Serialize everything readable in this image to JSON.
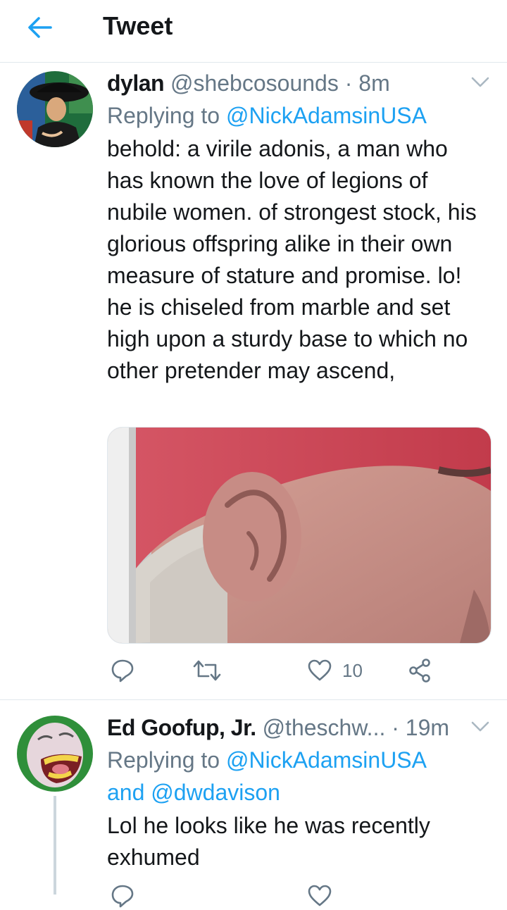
{
  "header": {
    "title": "Tweet",
    "back_icon": "arrow-left-icon",
    "accent": "#1da1f2"
  },
  "tweets": [
    {
      "name": "dylan",
      "handle": "@shebcosounds",
      "separator": "·",
      "time": "8m",
      "replying_prefix": "Replying to",
      "replying_to": "@NickAdamsinUSA",
      "text": "behold: a virile adonis, a man who has known the love of legions of nubile women. of strongest stock, his glorious offspring alike in their own measure of stature and promise. lo! he is chiseled from marble and set high upon a sturdy base to which no other pretender may ascend,",
      "media": "photo",
      "actions": {
        "reply_icon": "reply-icon",
        "retweet_icon": "retweet-icon",
        "like_icon": "heart-icon",
        "like_count": "10",
        "share_icon": "share-icon"
      }
    },
    {
      "name": "Ed Goofup, Jr.",
      "handle": "@theschw...",
      "separator": "·",
      "time": "19m",
      "replying_prefix": "Replying to",
      "replying_to": "@NickAdamsinUSA",
      "replying_conj": "and",
      "replying_to_2": "@dwdavison",
      "text": "Lol he looks like he was recently exhumed"
    }
  ],
  "colors": {
    "text": "#14171a",
    "secondary": "#657786",
    "link": "#1da1f2",
    "divider": "#e1e8ed"
  }
}
